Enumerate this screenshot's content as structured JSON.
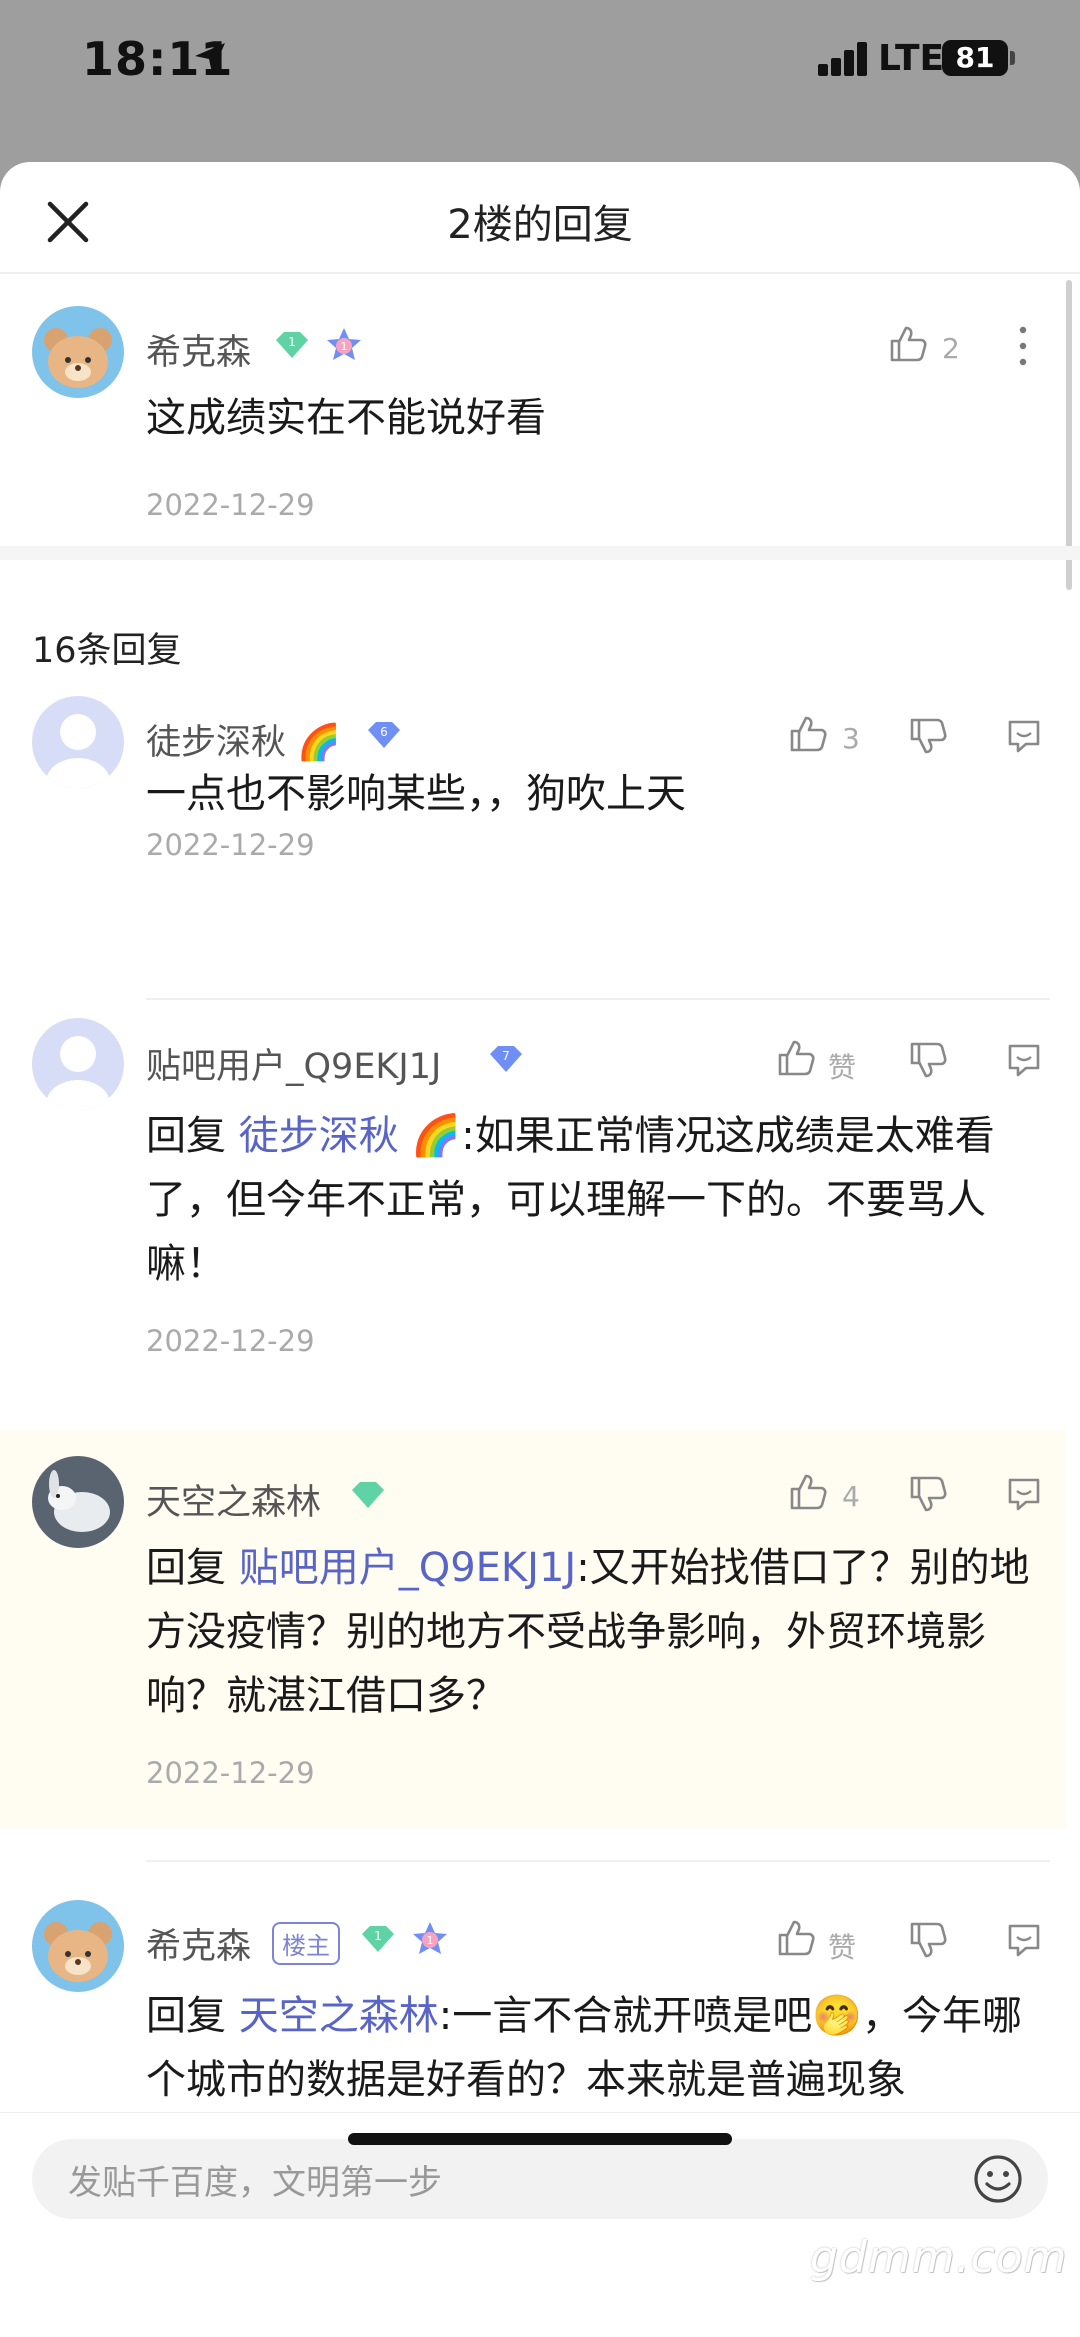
{
  "status_bar": {
    "time": "18:11",
    "network": "LTE",
    "battery": "81"
  },
  "header": {
    "title": "2楼的回复"
  },
  "main_post": {
    "username": "希克森",
    "text": "这成绩实在不能说好看",
    "date": "2022-12-29",
    "likes": "2"
  },
  "reply_count": "16条回复",
  "replies": [
    {
      "username": "徒步深秋",
      "level": "6",
      "likes": "3",
      "text": "一点也不影响某些，，狗吹上天",
      "date": "2022-12-29"
    },
    {
      "username": "贴吧用户_Q9EKJ1J",
      "level": "7",
      "likes": "赞",
      "reply_prefix": "回复 ",
      "reply_to": "徒步深秋",
      "text": ":如果正常情况这成绩是太难看了，但今年不正常，可以理解一下的。不要骂人嘛！",
      "date": "2022-12-29"
    },
    {
      "username": "天空之森林",
      "likes": "4",
      "reply_prefix": "回复 ",
      "reply_to": "贴吧用户_Q9EKJ1J",
      "text": ":又开始找借口了？别的地方没疫情？别的地方不受战争影响，外贸环境影响？就湛江借口多？",
      "date": "2022-12-29"
    },
    {
      "username": "希克森",
      "tag": "楼主",
      "likes": "赞",
      "reply_prefix": "回复 ",
      "reply_to": "天空之森林",
      "text": ":一言不合就开喷是吧",
      "text2": "，今年哪个城市的数据是好看的？本来就是普遍现象"
    }
  ],
  "input": {
    "placeholder": "发贴千百度，文明第一步"
  },
  "watermark": "gdmm.com",
  "colors": {
    "link": "#5964c7",
    "badge_green": "#5fd3a5",
    "badge_blue": "#6f8ff5",
    "highlight_bg": "#fffdf2"
  }
}
